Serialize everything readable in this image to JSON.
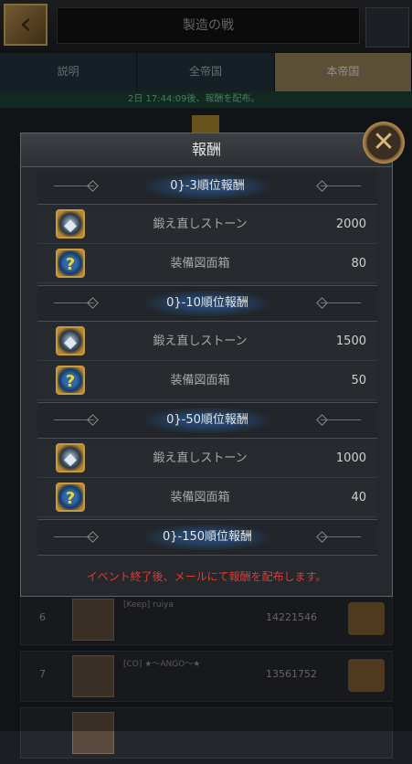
{
  "screen": {
    "title": "製造の戦",
    "tabs": [
      {
        "label": "説明",
        "active": false
      },
      {
        "label": "全帝国",
        "active": false
      },
      {
        "label": "本帝国",
        "active": true
      }
    ],
    "notice": "2日 17:44:09後、報酬を配布。",
    "ranking_rows": [
      {
        "rank": "6",
        "name": "[Keep] ruiya",
        "power": "14221546"
      },
      {
        "rank": "7",
        "name": "[CO] ★〜ANGO〜★",
        "power": "13561752"
      }
    ]
  },
  "modal": {
    "title": "報酬",
    "footer": "イベント終了後、メールにて報酬を配布します。",
    "sections": [
      {
        "header": "0}-3順位報酬",
        "items": [
          {
            "icon": "forge-stone-icon",
            "name": "鍛え直しストーン",
            "qty": "2000"
          },
          {
            "icon": "blueprint-box-icon",
            "name": "装備図面箱",
            "qty": "80"
          }
        ]
      },
      {
        "header": "0}-10順位報酬",
        "items": [
          {
            "icon": "forge-stone-icon",
            "name": "鍛え直しストーン",
            "qty": "1500"
          },
          {
            "icon": "blueprint-box-icon",
            "name": "装備図面箱",
            "qty": "50"
          }
        ]
      },
      {
        "header": "0}-50順位報酬",
        "items": [
          {
            "icon": "forge-stone-icon",
            "name": "鍛え直しストーン",
            "qty": "1000"
          },
          {
            "icon": "blueprint-box-icon",
            "name": "装備図面箱",
            "qty": "40"
          }
        ]
      },
      {
        "header": "0}-150順位報酬",
        "items": []
      }
    ]
  },
  "colors": {
    "accent_gold": "#c69a3a",
    "footer_red": "#e03a30",
    "active_tab": "#8d7c52"
  }
}
